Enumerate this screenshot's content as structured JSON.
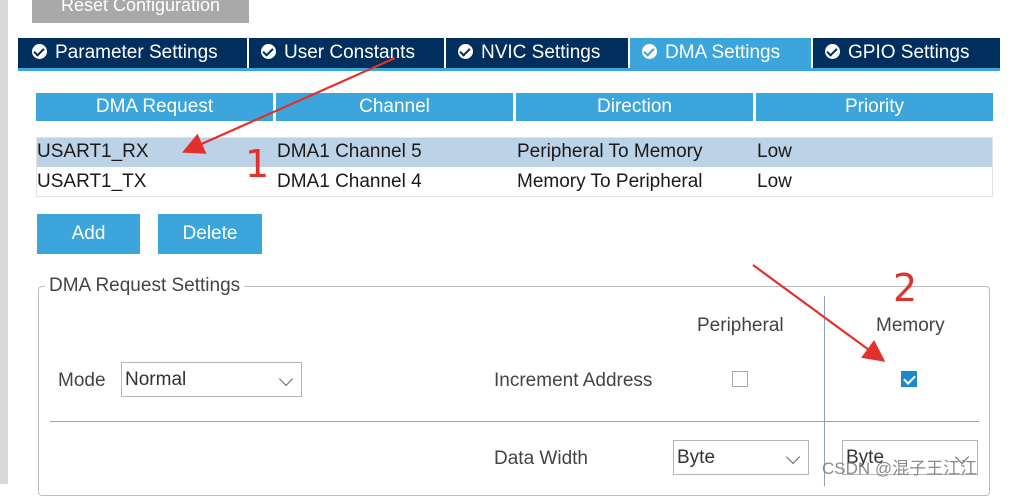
{
  "toolbar": {
    "reset_label": "Reset Configuration"
  },
  "tabs": [
    {
      "label": "Parameter Settings",
      "active": false
    },
    {
      "label": "User Constants",
      "active": false
    },
    {
      "label": "NVIC Settings",
      "active": false
    },
    {
      "label": "DMA Settings",
      "active": true
    },
    {
      "label": "GPIO Settings",
      "active": false
    }
  ],
  "dma_table": {
    "headers": [
      "DMA Request",
      "Channel",
      "Direction",
      "Priority"
    ],
    "rows": [
      {
        "request": "USART1_RX",
        "channel": "DMA1 Channel 5",
        "direction": "Peripheral To Memory",
        "priority": "Low",
        "selected": true
      },
      {
        "request": "USART1_TX",
        "channel": "DMA1 Channel 4",
        "direction": "Memory To Peripheral",
        "priority": "Low",
        "selected": false
      }
    ]
  },
  "buttons": {
    "add": "Add",
    "delete": "Delete"
  },
  "request_settings": {
    "title": "DMA Request Settings",
    "peripheral_header": "Peripheral",
    "memory_header": "Memory",
    "mode_label": "Mode",
    "mode_value": "Normal",
    "increment_label": "Increment Address",
    "increment_peripheral": false,
    "increment_memory": true,
    "data_width_label": "Data Width",
    "peripheral_width": "Byte",
    "memory_width": "Byte"
  },
  "annotations": {
    "marker_1": "1",
    "marker_2": "2",
    "arrow_color": "#e2302b"
  },
  "watermark": "CSDN @混子王江江",
  "colors": {
    "tab_bg": "#002f5d",
    "accent": "#3ca6dc",
    "selected_row": "#bcd2e6"
  }
}
